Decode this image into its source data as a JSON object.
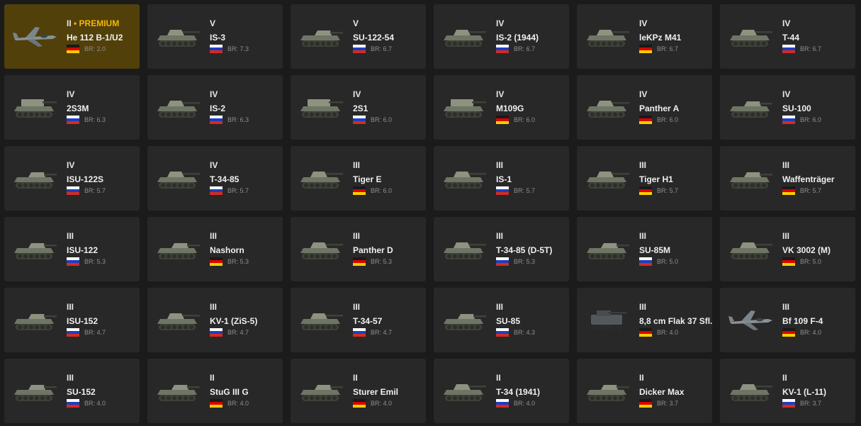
{
  "colors": {
    "background": "#1b1b1b",
    "card": "#282828",
    "premium_card": "#51400a",
    "premium_text": "#f2b705",
    "br_text": "#8e8e8e"
  },
  "vehicles": [
    {
      "tier": "II",
      "premium_label": "PREMIUM",
      "premium": true,
      "name": "He 112 B-1/U2",
      "nation": "germany",
      "br": "BR: 2.0",
      "icon": "plane-icon"
    },
    {
      "tier": "V",
      "name": "IS-3",
      "nation": "ussr",
      "br": "BR: 7.3",
      "icon": "tank-icon"
    },
    {
      "tier": "V",
      "name": "SU-122-54",
      "nation": "ussr",
      "br": "BR: 6.7",
      "icon": "tank-destroyer-icon"
    },
    {
      "tier": "IV",
      "name": "IS-2 (1944)",
      "nation": "ussr",
      "br": "BR: 6.7",
      "icon": "tank-icon"
    },
    {
      "tier": "IV",
      "name": "leKPz M41",
      "nation": "germany",
      "br": "BR: 6.7",
      "icon": "tank-icon"
    },
    {
      "tier": "IV",
      "name": "T-44",
      "nation": "ussr",
      "br": "BR: 6.7",
      "icon": "tank-icon"
    },
    {
      "tier": "IV",
      "name": "2S3M",
      "nation": "ussr",
      "br": "BR: 6.3",
      "icon": "spg-icon"
    },
    {
      "tier": "IV",
      "name": "IS-2",
      "nation": "ussr",
      "br": "BR: 6.3",
      "icon": "tank-icon"
    },
    {
      "tier": "IV",
      "name": "2S1",
      "nation": "ussr",
      "br": "BR: 6.0",
      "icon": "spg-icon"
    },
    {
      "tier": "IV",
      "name": "M109G",
      "nation": "germany",
      "br": "BR: 6.0",
      "icon": "spg-icon"
    },
    {
      "tier": "IV",
      "name": "Panther A",
      "nation": "germany",
      "br": "BR: 6.0",
      "icon": "tank-icon"
    },
    {
      "tier": "IV",
      "name": "SU-100",
      "nation": "ussr",
      "br": "BR: 6.0",
      "icon": "tank-destroyer-icon"
    },
    {
      "tier": "IV",
      "name": "ISU-122S",
      "nation": "ussr",
      "br": "BR: 5.7",
      "icon": "tank-destroyer-icon"
    },
    {
      "tier": "IV",
      "name": "T-34-85",
      "nation": "ussr",
      "br": "BR: 5.7",
      "icon": "tank-icon"
    },
    {
      "tier": "III",
      "name": "Tiger E",
      "nation": "germany",
      "br": "BR: 6.0",
      "icon": "tank-icon"
    },
    {
      "tier": "III",
      "name": "IS-1",
      "nation": "ussr",
      "br": "BR: 5.7",
      "icon": "tank-icon"
    },
    {
      "tier": "III",
      "name": "Tiger H1",
      "nation": "germany",
      "br": "BR: 5.7",
      "icon": "tank-icon"
    },
    {
      "tier": "III",
      "name": "Waffenträger",
      "nation": "germany",
      "br": "BR: 5.7",
      "icon": "tank-destroyer-icon"
    },
    {
      "tier": "III",
      "name": "ISU-122",
      "nation": "ussr",
      "br": "BR: 5.3",
      "icon": "tank-destroyer-icon"
    },
    {
      "tier": "III",
      "name": "Nashorn",
      "nation": "germany",
      "br": "BR: 5.3",
      "icon": "tank-destroyer-icon"
    },
    {
      "tier": "III",
      "name": "Panther D",
      "nation": "germany",
      "br": "BR: 5.3",
      "icon": "tank-icon"
    },
    {
      "tier": "III",
      "name": "T-34-85 (D-5T)",
      "nation": "ussr",
      "br": "BR: 5.3",
      "icon": "tank-icon"
    },
    {
      "tier": "III",
      "name": "SU-85M",
      "nation": "ussr",
      "br": "BR: 5.0",
      "icon": "tank-destroyer-icon"
    },
    {
      "tier": "III",
      "name": "VK 3002 (M)",
      "nation": "germany",
      "br": "BR: 5.0",
      "icon": "tank-icon"
    },
    {
      "tier": "III",
      "name": "ISU-152",
      "nation": "ussr",
      "br": "BR: 4.7",
      "icon": "tank-destroyer-icon"
    },
    {
      "tier": "III",
      "name": "KV-1 (ZiS-5)",
      "nation": "ussr",
      "br": "BR: 4.7",
      "icon": "tank-icon"
    },
    {
      "tier": "III",
      "name": "T-34-57",
      "nation": "ussr",
      "br": "BR: 4.7",
      "icon": "tank-icon"
    },
    {
      "tier": "III",
      "name": "SU-85",
      "nation": "ussr",
      "br": "BR: 4.3",
      "icon": "tank-destroyer-icon"
    },
    {
      "tier": "III",
      "name": "8,8 cm Flak 37 Sfl.",
      "nation": "germany",
      "br": "BR: 4.0",
      "icon": "halftrack-icon"
    },
    {
      "tier": "III",
      "name": "Bf 109 F-4",
      "nation": "germany",
      "br": "BR: 4.0",
      "icon": "plane-icon"
    },
    {
      "tier": "III",
      "name": "SU-152",
      "nation": "ussr",
      "br": "BR: 4.0",
      "icon": "tank-destroyer-icon"
    },
    {
      "tier": "II",
      "name": "StuG III G",
      "nation": "germany",
      "br": "BR: 4.0",
      "icon": "tank-destroyer-icon"
    },
    {
      "tier": "II",
      "name": "Sturer Emil",
      "nation": "germany",
      "br": "BR: 4.0",
      "icon": "tank-destroyer-icon"
    },
    {
      "tier": "II",
      "name": "T-34 (1941)",
      "nation": "ussr",
      "br": "BR: 4.0",
      "icon": "tank-icon"
    },
    {
      "tier": "II",
      "name": "Dicker Max",
      "nation": "germany",
      "br": "BR: 3.7",
      "icon": "tank-destroyer-icon"
    },
    {
      "tier": "II",
      "name": "KV-1 (L-11)",
      "nation": "ussr",
      "br": "BR: 3.7",
      "icon": "tank-icon"
    }
  ]
}
